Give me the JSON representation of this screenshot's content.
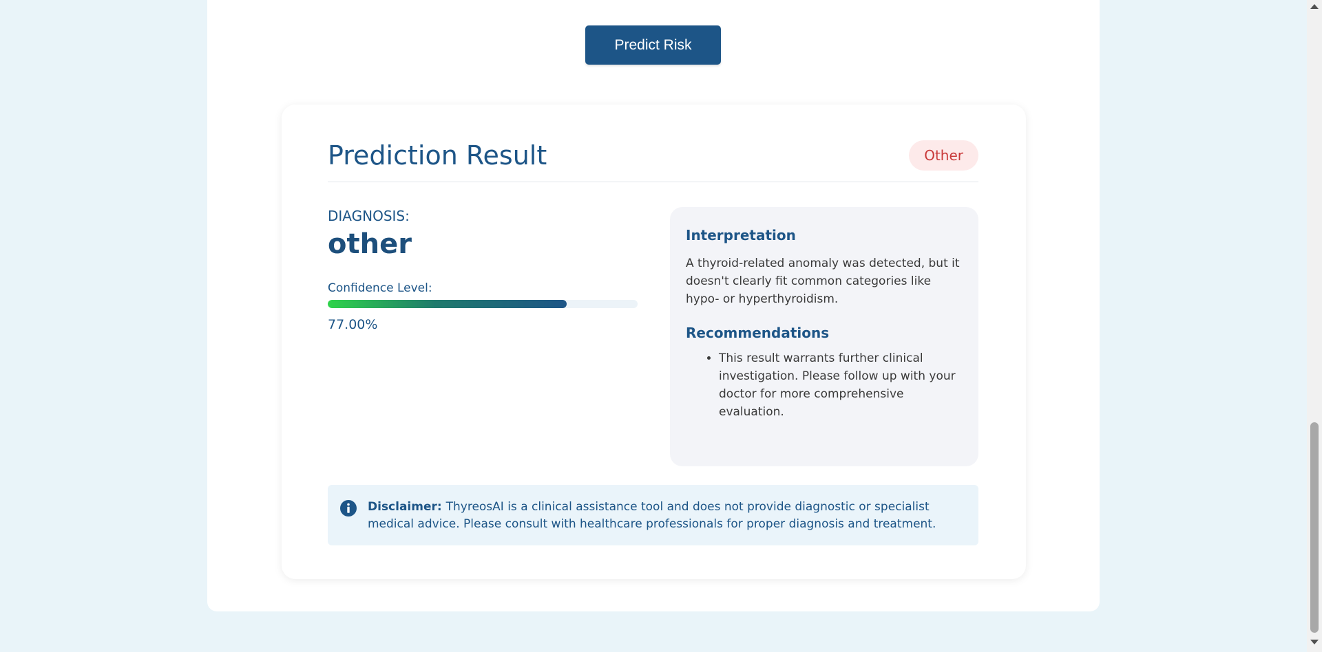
{
  "actions": {
    "predict_label": "Predict Risk"
  },
  "result": {
    "title": "Prediction Result",
    "badge": "Other",
    "diagnosis_label": "DIAGNOSIS:",
    "diagnosis_value": "other",
    "confidence_label": "Confidence Level:",
    "confidence_fraction": 0.77,
    "confidence_text": "77.00%"
  },
  "interpretation": {
    "heading": "Interpretation",
    "text": "A thyroid-related anomaly was detected, but it doesn't clearly fit common categories like hypo- or hyperthyroidism.",
    "recommendations_heading": "Recommendations",
    "recommendations": [
      "This result warrants further clinical investigation. Please follow up with your doctor for more comprehensive evaluation."
    ]
  },
  "disclaimer": {
    "label": "Disclaimer:",
    "text": "ThyreosAI is a clinical assistance tool and does not provide diagnostic or specialist medical advice. Please consult with healthcare professionals for proper diagnosis and treatment."
  },
  "icons": {
    "disclaimer_icon": "info-icon"
  },
  "colors": {
    "primary": "#1d5587",
    "badge_bg": "#fdeaea",
    "badge_text": "#c93a3a",
    "background": "#e9f4f9"
  }
}
